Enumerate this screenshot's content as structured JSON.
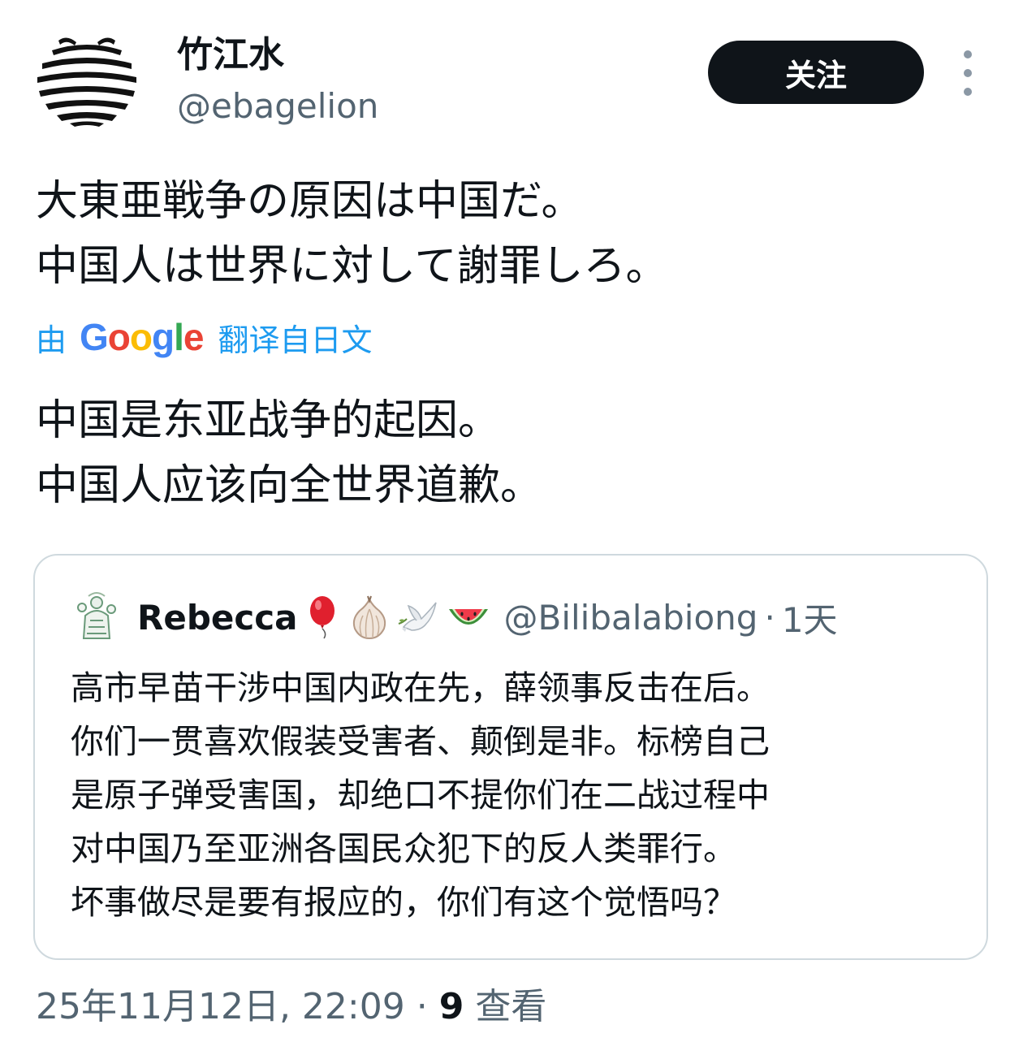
{
  "author": {
    "display_name": "竹江水",
    "handle": "@ebagelion",
    "avatar_icon": "striped-frog-avatar"
  },
  "follow_button": {
    "label": "关注"
  },
  "more_button": {
    "icon": "more-vertical-icon"
  },
  "tweet": {
    "lines": [
      "大東亜戦争の原因は中国だ。",
      "中国人は世界に対して謝罪しろ。"
    ]
  },
  "translation": {
    "prefix": "由",
    "provider": "Google",
    "suffix": "翻译自日文",
    "lines": [
      "中国是东亚战争的起因。",
      "中国人应该向全世界道歉。"
    ]
  },
  "quote": {
    "display_name": "Rebecca",
    "name_emojis": [
      "balloon-icon",
      "garlic-icon",
      "dove-icon",
      "watermelon-icon"
    ],
    "handle": "@Bilibalabiong",
    "separator": "·",
    "time": "1天",
    "lines": [
      "高市早苗干涉中国内政在先，薛领事反击在后。",
      "你们一贯喜欢假装受害者、颠倒是非。标榜自己",
      "是原子弹受害国，却绝口不提你们在二战过程中",
      "对中国乃至亚洲各国民众犯下的反人类罪行。",
      "坏事做尽是要有报应的，你们有这个觉悟吗？"
    ]
  },
  "meta": {
    "date": "25年11月12日, 22:09",
    "separator": "·",
    "views_count": "9",
    "views_label": "查看"
  },
  "colors": {
    "text": "#0f1419",
    "secondary": "#536471",
    "link": "#1d9bf0",
    "border": "#cfd9de",
    "button_bg": "#0f1419"
  }
}
